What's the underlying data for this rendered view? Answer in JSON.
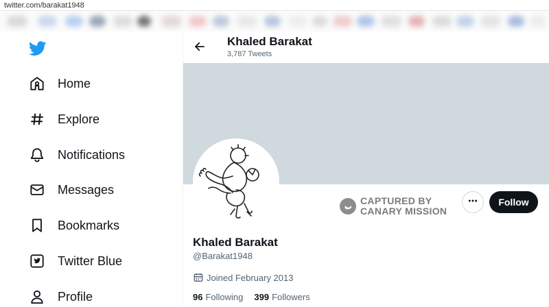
{
  "browser": {
    "url": "twitter.com/barakat1948"
  },
  "sidebar": {
    "logo_icon": "twitter-bird-icon",
    "items": [
      {
        "label": "Home",
        "icon": "home-icon"
      },
      {
        "label": "Explore",
        "icon": "hashtag-icon"
      },
      {
        "label": "Notifications",
        "icon": "bell-icon"
      },
      {
        "label": "Messages",
        "icon": "envelope-icon"
      },
      {
        "label": "Bookmarks",
        "icon": "bookmark-icon"
      },
      {
        "label": "Twitter Blue",
        "icon": "twitter-blue-icon"
      },
      {
        "label": "Profile",
        "icon": "person-icon"
      }
    ]
  },
  "header": {
    "name": "Khaled Barakat",
    "tweets": "3,787 Tweets"
  },
  "profile": {
    "name": "Khaled Barakat",
    "handle": "@Barakat1948",
    "joined": "Joined February 2013",
    "following_count": "96",
    "following_label": "Following",
    "followers_count": "399",
    "followers_label": "Followers",
    "follow_label": "Follow",
    "banner_color": "#cfd9de"
  },
  "watermark": {
    "line1": "CAPTURED BY",
    "line2": "CANARY MISSION"
  },
  "colors": {
    "brand": "#1d9bf0",
    "text": "#0f1419",
    "muted": "#536471"
  }
}
